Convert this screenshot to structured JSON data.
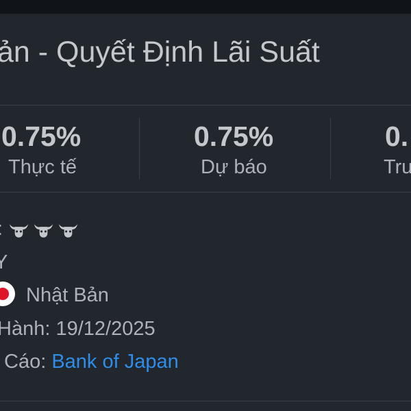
{
  "header": {
    "title": "ản - Quyết Định Lãi Suất"
  },
  "stats": [
    {
      "value": "0.75%",
      "label": "Thực tế"
    },
    {
      "value": "0.75%",
      "label": "Dự báo"
    },
    {
      "value": "0.",
      "label": "Trư"
    }
  ],
  "details": {
    "importance_label": ":",
    "importance_icons": [
      "bull-icon",
      "bull-icon",
      "bull-icon"
    ],
    "currency_fragment": "Y",
    "country_flag_icon": "japan-flag-icon",
    "country": "Nhật Bản",
    "release_label": "Hành:",
    "release_date": "19/12/2025",
    "source_label": "Cáo:",
    "source_link": "Bank of Japan"
  },
  "colors": {
    "background": "#22272e",
    "text": "#c4c7cb",
    "muted_text": "#aeb2b8",
    "link": "#2f8dea",
    "divider": "#3a4048",
    "flag_red": "#e0142a"
  }
}
